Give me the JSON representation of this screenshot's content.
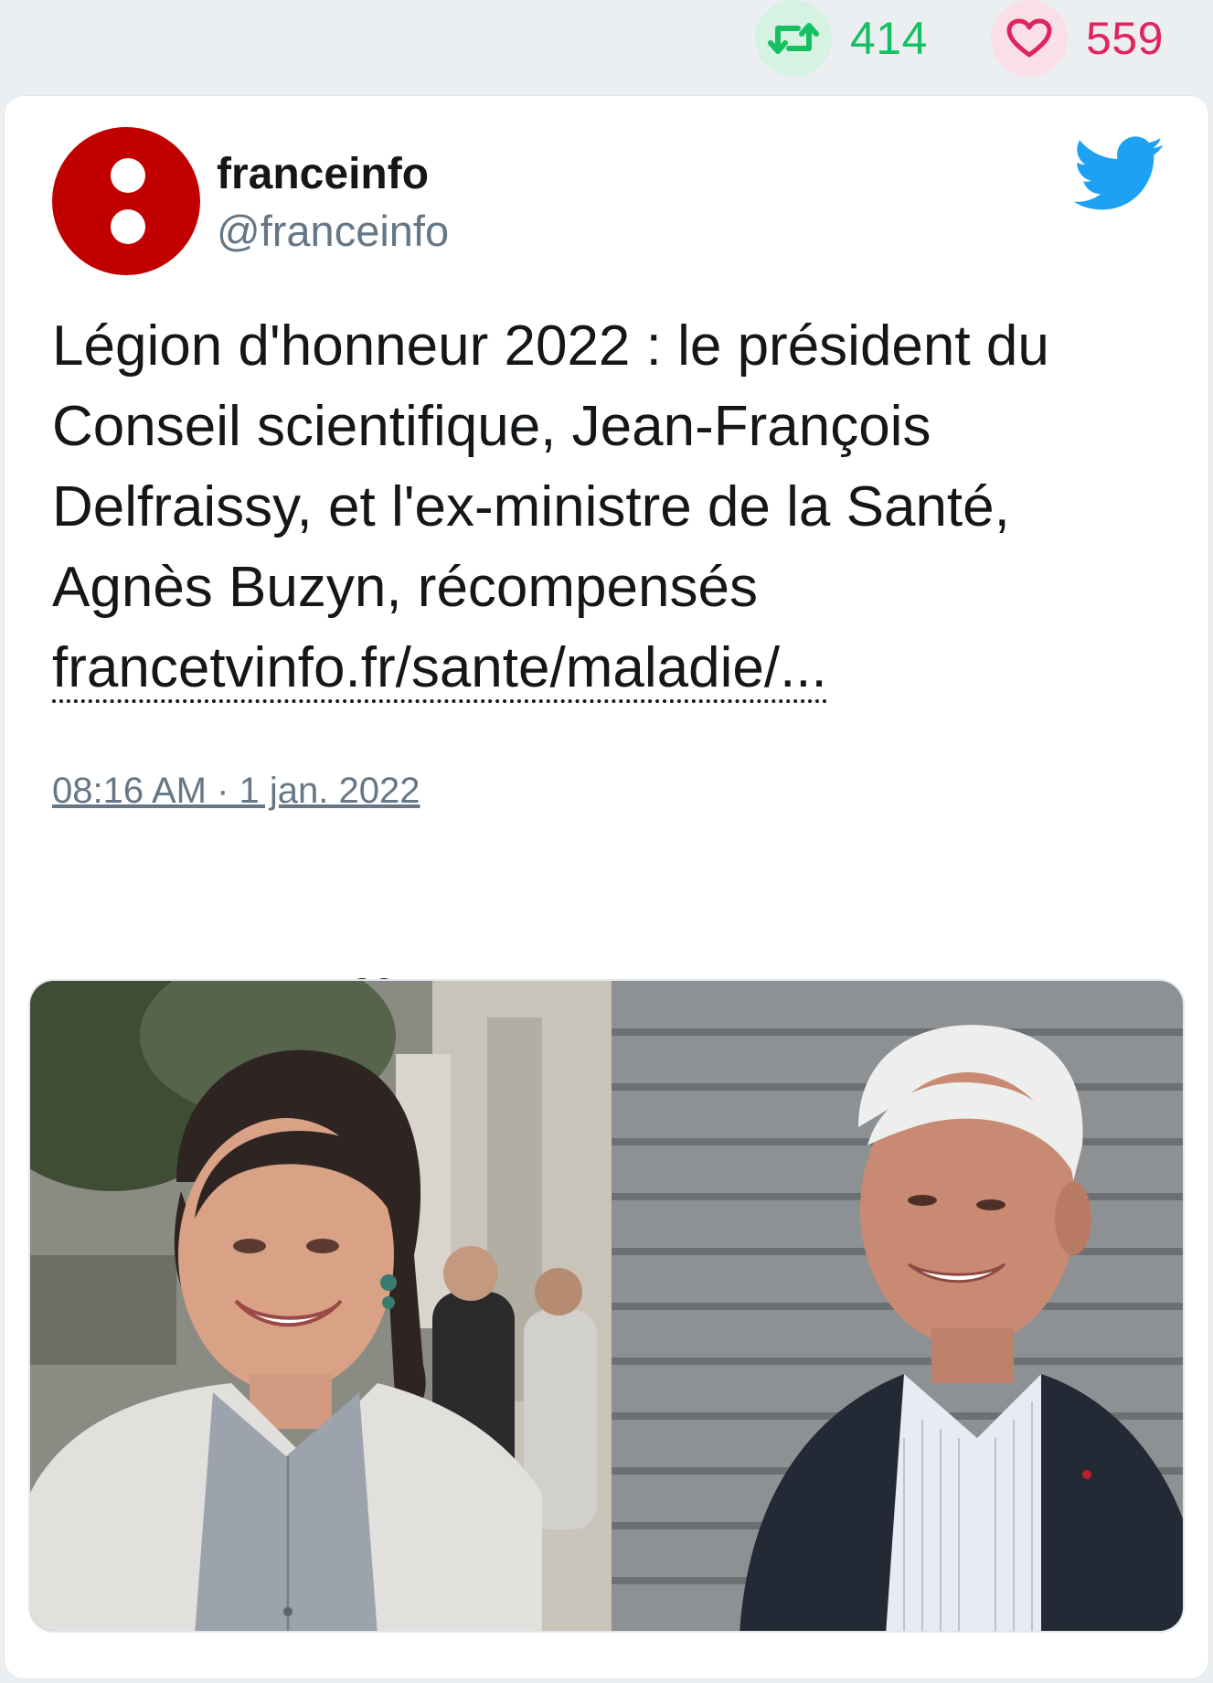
{
  "stats": {
    "retweet_count": "414",
    "like_count": "559"
  },
  "tweet": {
    "display_name": "franceinfo",
    "handle": "@franceinfo",
    "text_lines": [
      "Légion d'honneur 2022 : le président du",
      "Conseil scientifique, Jean-François",
      "Delfraissy, et l'ex-ministre de la Santé,",
      "Agnès Buzyn, récompensés"
    ],
    "link": "francetvinfo.fr/sante/maladie/...",
    "timestamp": "08:16 AM · 1 jan. 2022"
  },
  "icons": {
    "retweet": "retweet-icon",
    "like": "heart-icon",
    "reply": "reply-icon",
    "brand": "twitter-bird-icon"
  },
  "colors": {
    "retweet": "#17bf63",
    "like": "#e0245e",
    "twitter_blue": "#1da1f2",
    "avatar_red": "#c10000"
  }
}
